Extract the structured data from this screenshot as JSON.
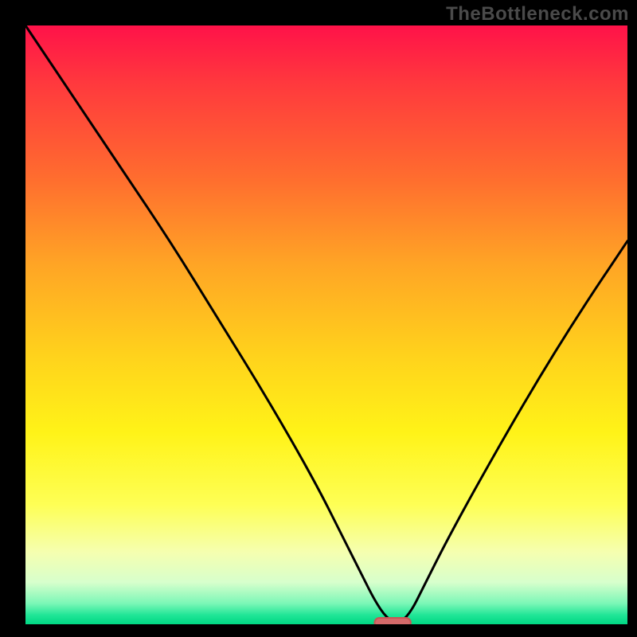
{
  "watermark": "TheBottleneck.com",
  "colors": {
    "frame": "#000000",
    "watermark": "#4a4a4a",
    "curve": "#000000",
    "marker_fill": "#d46a6a",
    "marker_stroke": "#c75555",
    "gradient_stops": [
      {
        "offset": 0.0,
        "color": "#ff1249"
      },
      {
        "offset": 0.1,
        "color": "#ff3a3d"
      },
      {
        "offset": 0.25,
        "color": "#ff6b2f"
      },
      {
        "offset": 0.4,
        "color": "#ffa525"
      },
      {
        "offset": 0.55,
        "color": "#ffd21c"
      },
      {
        "offset": 0.68,
        "color": "#fff318"
      },
      {
        "offset": 0.8,
        "color": "#feff55"
      },
      {
        "offset": 0.88,
        "color": "#f5ffb0"
      },
      {
        "offset": 0.93,
        "color": "#d7ffcc"
      },
      {
        "offset": 0.965,
        "color": "#7cf7b7"
      },
      {
        "offset": 0.985,
        "color": "#1fe596"
      },
      {
        "offset": 1.0,
        "color": "#00d884"
      }
    ]
  },
  "chart_data": {
    "type": "line",
    "title": "",
    "xlabel": "",
    "ylabel": "",
    "xlim": [
      0,
      100
    ],
    "ylim": [
      0,
      100
    ],
    "grid": false,
    "legend": false,
    "series": [
      {
        "name": "bottleneck-curve",
        "x": [
          0,
          8,
          16,
          24,
          32,
          40,
          48,
          53,
          56,
          58,
          60,
          62,
          64,
          66,
          70,
          76,
          84,
          92,
          100
        ],
        "values": [
          100,
          88,
          76,
          64,
          51,
          38,
          24,
          14,
          8,
          4,
          1,
          0,
          2,
          6,
          14,
          25,
          39,
          52,
          64
        ]
      }
    ],
    "marker": {
      "name": "optimal-range",
      "x_center": 61,
      "y": 0,
      "width": 6
    }
  }
}
